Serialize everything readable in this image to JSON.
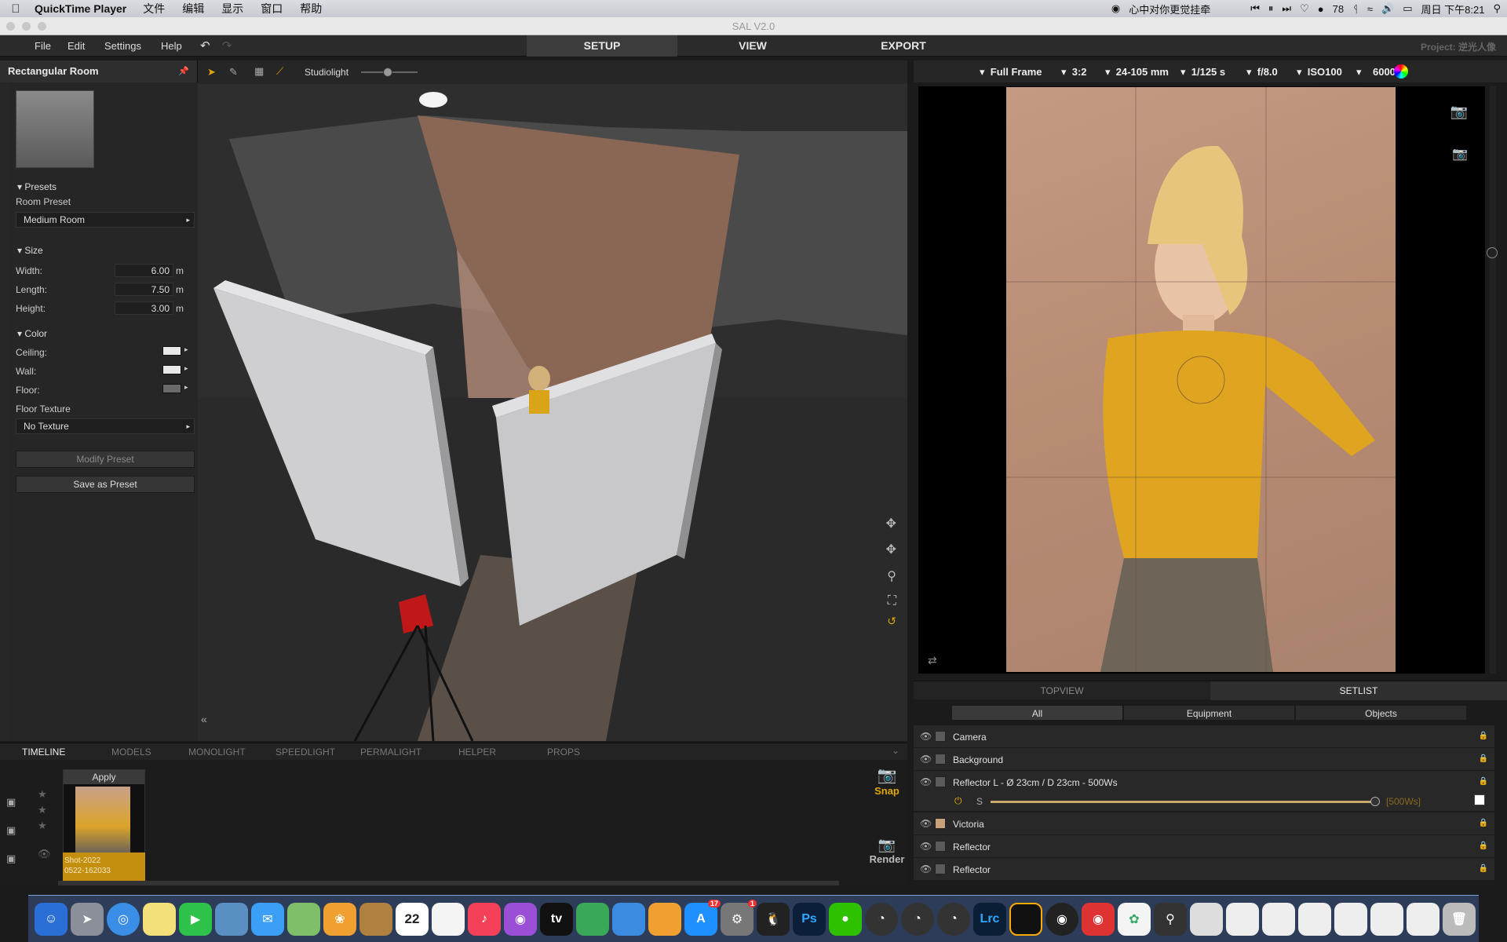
{
  "menubar": {
    "app": "QuickTime Player",
    "items": [
      "文件",
      "编辑",
      "显示",
      "窗口",
      "帮助"
    ],
    "now_playing": "心中对你更觉挂牵",
    "badge_78": "78",
    "clock": "周日 下午8:21"
  },
  "window": {
    "title": "SAL V2.0"
  },
  "appmenu": {
    "file": "File",
    "edit": "Edit",
    "settings": "Settings",
    "help": "Help"
  },
  "tabs": {
    "setup": "SETUP",
    "view": "VIEW",
    "export": "EXPORT",
    "project": "Project: 逆光人像"
  },
  "left_panel": {
    "title": "Rectangular Room",
    "presets": "Presets",
    "room_preset_label": "Room Preset",
    "room_preset_value": "Medium Room",
    "size": "Size",
    "width_label": "Width:",
    "width_value": "6.00",
    "length_label": "Length:",
    "length_value": "7.50",
    "height_label": "Height:",
    "height_value": "3.00",
    "unit": "m",
    "color": "Color",
    "ceiling": "Ceiling:",
    "wall": "Wall:",
    "floor": "Floor:",
    "floor_texture": "Floor Texture",
    "floor_texture_value": "No Texture",
    "modify": "Modify Preset",
    "save": "Save as Preset"
  },
  "viewport": {
    "studiolight": "Studiolight"
  },
  "camera_bar": {
    "frame": "Full Frame",
    "ratio": "3:2",
    "lens": "24-105 mm",
    "shutter": "1/125 s",
    "aperture": "f/8.0",
    "iso": "ISO100",
    "wb": "6000K"
  },
  "right_tabs": {
    "topview": "TOPVIEW",
    "setlist": "SETLIST"
  },
  "filters": {
    "all": "All",
    "equipment": "Equipment",
    "objects": "Objects"
  },
  "setlist": [
    {
      "name": "Camera"
    },
    {
      "name": "Background"
    },
    {
      "name": "Reflector L - Ø 23cm / D 23cm - 500Ws"
    },
    {
      "name": "Victoria"
    },
    {
      "name": "Reflector"
    },
    {
      "name": "Reflector"
    }
  ],
  "reflector_power": {
    "s": "S",
    "value": "[500Ws]",
    "level": 1.0
  },
  "bottom_tabs": {
    "timeline": "TIMELINE",
    "models": "MODELS",
    "monolight": "MONOLIGHT",
    "speedlight": "SPEEDLIGHT",
    "permalight": "PERMALIGHT",
    "helper": "HELPER",
    "props": "PROPS"
  },
  "timeline": {
    "apply": "Apply",
    "shot_line1": "Shot-2022",
    "shot_line2": "0522-162033"
  },
  "actions": {
    "snap": "Snap",
    "render": "Render"
  },
  "dock": {
    "calendar_day": "22",
    "photoshop": "Ps",
    "lightroom": "Lrc",
    "appstore_badge": "17",
    "settings_badge": "1"
  },
  "colors": {
    "accent": "#e0a800",
    "ceiling": "#e8e8e8",
    "wall": "#e8e8e8",
    "floor": "#6a6a6a"
  }
}
